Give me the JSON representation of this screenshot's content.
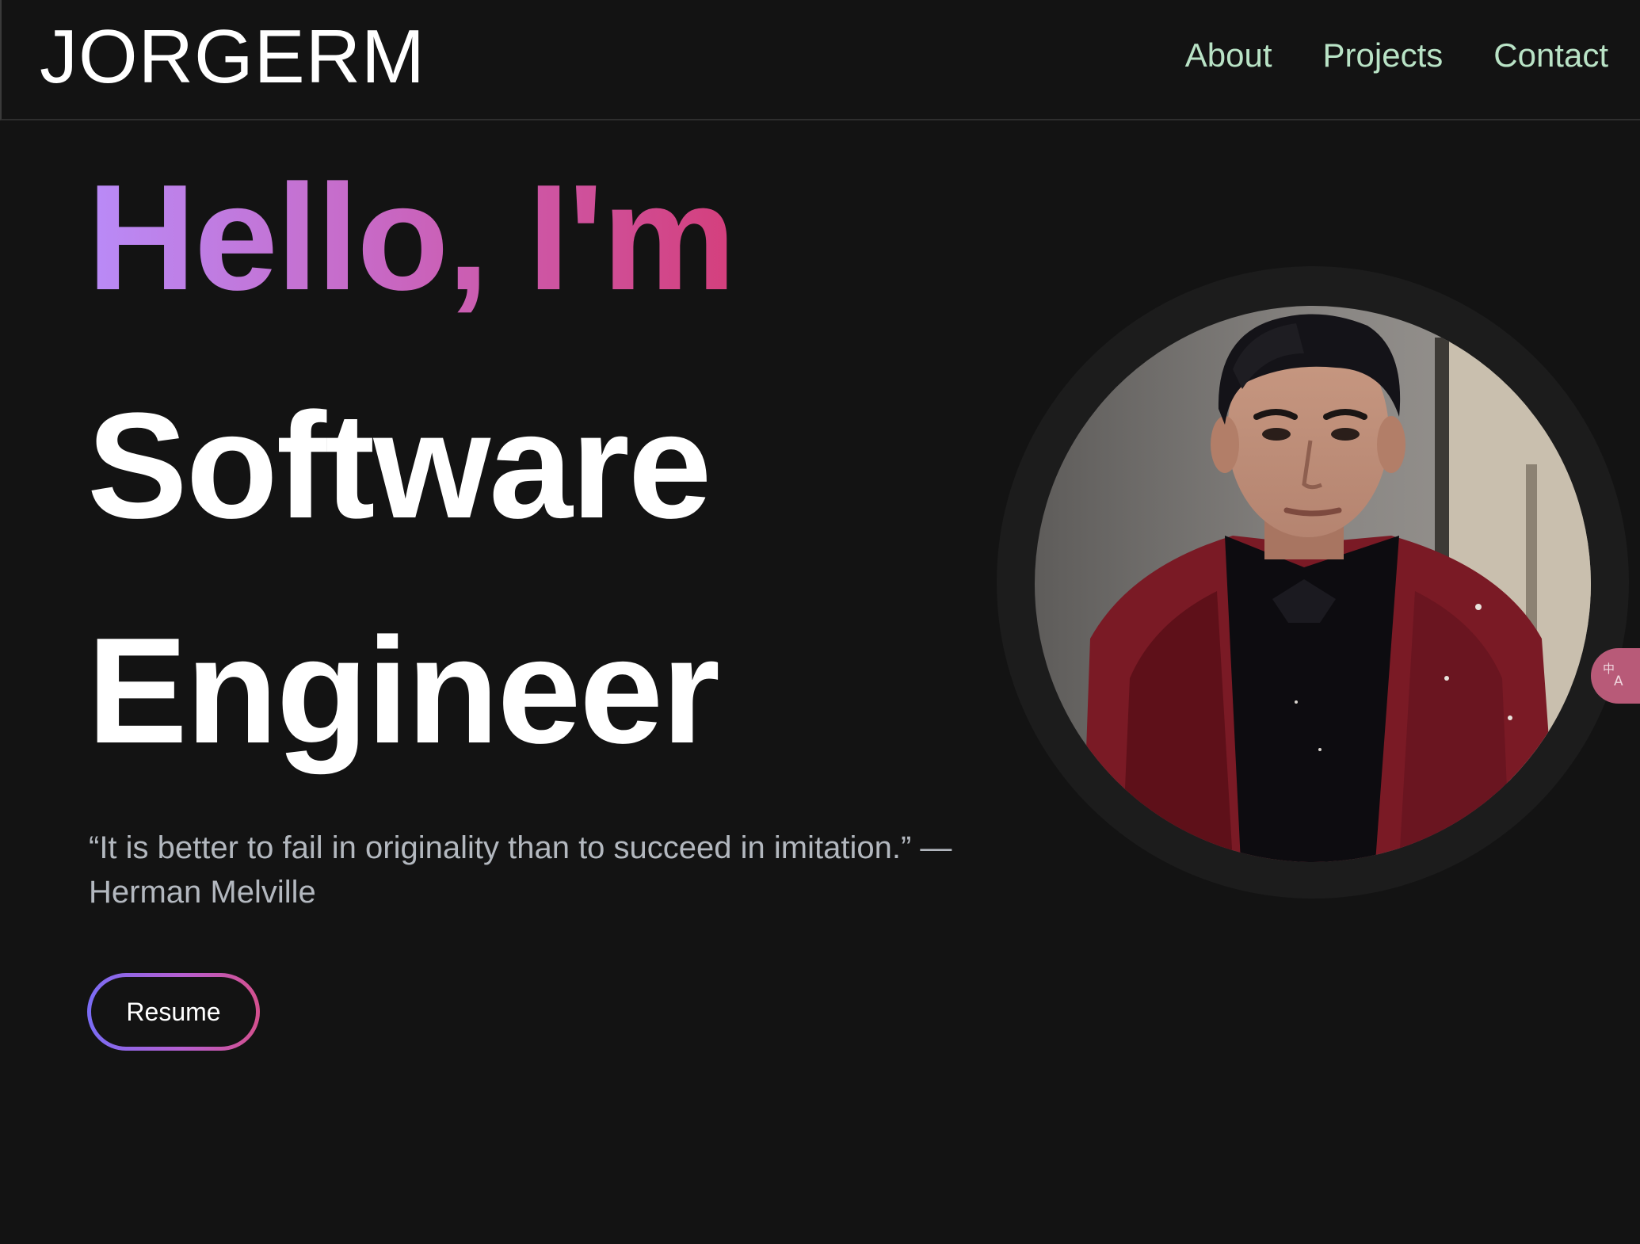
{
  "brand": "JORGERM",
  "nav": {
    "items": [
      {
        "label": "About"
      },
      {
        "label": "Projects"
      },
      {
        "label": "Contact"
      }
    ]
  },
  "hero": {
    "greeting": "Hello, I'm",
    "title_line1": "Software",
    "title_line2": "Engineer",
    "quote_line1": "“It is better to fail in originality than to succeed in imitation.” —",
    "quote_line2": "Herman Melville",
    "resume_label": "Resume"
  },
  "colors": {
    "background": "#131313",
    "nav_link": "#b9e3c6",
    "gradient_start": "#b98bf8",
    "gradient_end": "#d43f7c",
    "quote_text": "#b3b8bf"
  },
  "icons": {
    "translate": "translate-icon"
  }
}
